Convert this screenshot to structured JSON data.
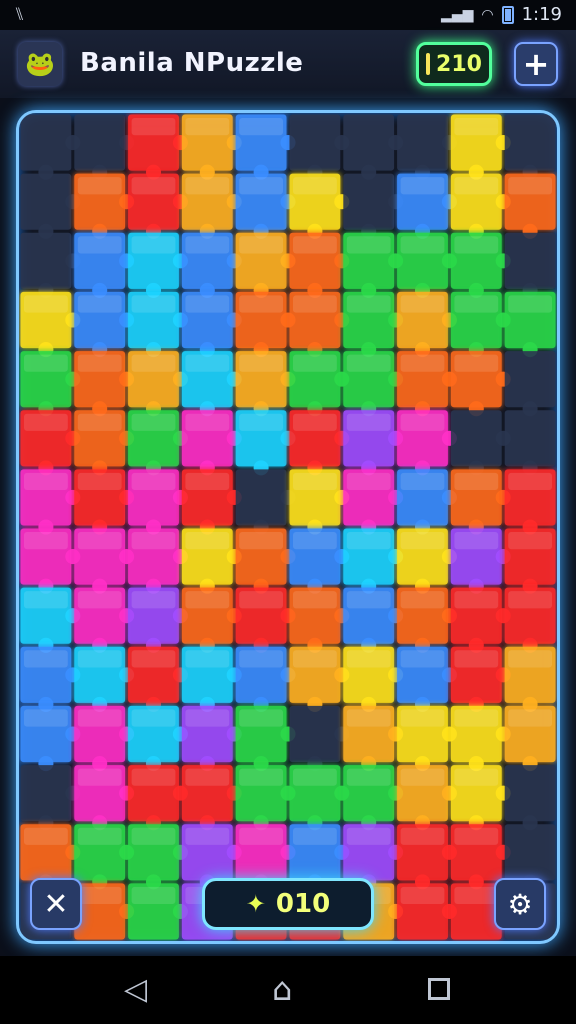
{
  "status": {
    "time": "1:19",
    "carrier": "ᐰ",
    "signal_label": "▂▄▆"
  },
  "header": {
    "title": "Banila NPuzzle",
    "coins": "210",
    "plus_label": "+",
    "avatar_icon": "🐸"
  },
  "footer": {
    "close_label": "✕",
    "score": "010",
    "settings_label": "⚙"
  },
  "board": {
    "palette": [
      "#ff2a2a",
      "#ff6a1a",
      "#ffb020",
      "#ffe21a",
      "#b8ff2a",
      "#2bd94a",
      "#1fd3ff",
      "#3a8dff",
      "#a04dff",
      "#ff2fc6",
      "#ff4a6a",
      "#2a3550"
    ],
    "cols": 10,
    "rows": 14,
    "grid": [
      [
        11,
        11,
        0,
        2,
        7,
        11,
        11,
        11,
        3,
        11
      ],
      [
        11,
        1,
        0,
        2,
        7,
        3,
        11,
        7,
        3,
        1
      ],
      [
        11,
        7,
        6,
        7,
        2,
        1,
        5,
        5,
        5,
        11
      ],
      [
        3,
        7,
        6,
        7,
        1,
        1,
        5,
        2,
        5,
        5
      ],
      [
        5,
        1,
        2,
        6,
        2,
        5,
        5,
        1,
        1,
        11
      ],
      [
        0,
        1,
        5,
        9,
        6,
        0,
        8,
        9,
        11,
        11
      ],
      [
        9,
        0,
        9,
        0,
        11,
        3,
        9,
        7,
        1,
        0
      ],
      [
        9,
        9,
        9,
        3,
        1,
        7,
        6,
        3,
        8,
        0
      ],
      [
        6,
        9,
        8,
        1,
        0,
        1,
        7,
        1,
        0,
        0
      ],
      [
        7,
        6,
        0,
        6,
        7,
        2,
        3,
        7,
        0,
        2
      ],
      [
        7,
        9,
        6,
        8,
        5,
        11,
        2,
        3,
        3,
        2
      ],
      [
        11,
        9,
        0,
        0,
        5,
        5,
        5,
        2,
        3,
        11
      ],
      [
        1,
        5,
        5,
        8,
        9,
        7,
        8,
        0,
        0,
        11
      ],
      [
        11,
        1,
        5,
        8,
        0,
        0,
        2,
        0,
        0,
        11
      ]
    ]
  }
}
